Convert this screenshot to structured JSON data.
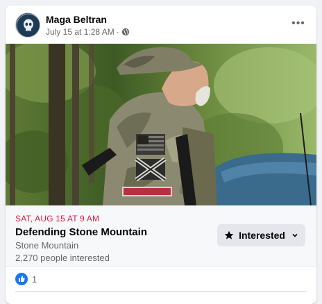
{
  "post": {
    "author": "Maga Beltran",
    "timestamp": "July 15 at 1:28 AM",
    "separator": "·",
    "privacy_icon": "globe-icon",
    "more_icon": "more-options-icon",
    "more_label": "•••"
  },
  "event": {
    "date": "SAT, AUG 15 AT 9 AM",
    "title": "Defending Stone Mountain",
    "location": "Stone Mountain",
    "interested_count": "2,270 people interested",
    "button_label": "Interested",
    "button_icon": "star-icon",
    "colors": {
      "date": "#e41e3f",
      "button_bg": "#e4e6eb"
    }
  },
  "reactions": {
    "icon": "like-icon",
    "count": "1",
    "color": "#1877f2"
  }
}
